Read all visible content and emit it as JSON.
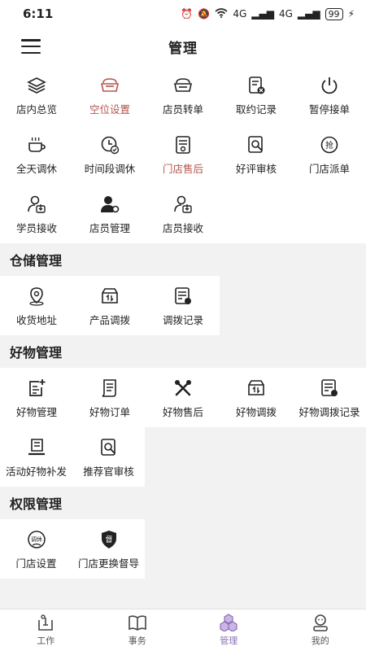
{
  "status_bar": {
    "time": "6:11",
    "network_1": "4G",
    "network_2": "4G",
    "battery": "99"
  },
  "header": {
    "title": "管理"
  },
  "sections": [
    {
      "title": "",
      "items": [
        {
          "label": "店内总览",
          "icon": "layers-icon"
        },
        {
          "label": "空位设置",
          "icon": "sofa-icon",
          "active": true
        },
        {
          "label": "店员转单",
          "icon": "sofa-transfer-icon"
        },
        {
          "label": "取约记录",
          "icon": "cancel-record-icon"
        },
        {
          "label": "暂停接单",
          "icon": "power-icon"
        },
        {
          "label": "全天调休",
          "icon": "coffee-cup-icon"
        },
        {
          "label": "时间段调休",
          "icon": "clock-check-icon"
        },
        {
          "label": "门店售后",
          "icon": "store-aftersale-icon",
          "active": true
        },
        {
          "label": "好评审核",
          "icon": "review-search-icon"
        },
        {
          "label": "门店派单",
          "icon": "grab-order-icon"
        },
        {
          "label": "学员接收",
          "icon": "person-download-icon"
        },
        {
          "label": "店员管理",
          "icon": "person-gear-icon"
        },
        {
          "label": "店员接收",
          "icon": "person-download-icon"
        }
      ]
    },
    {
      "title": "仓储管理",
      "items": [
        {
          "label": "收货地址",
          "icon": "location-pin-icon"
        },
        {
          "label": "产品调拨",
          "icon": "box-transfer-icon"
        },
        {
          "label": "调拨记录",
          "icon": "record-list-icon"
        }
      ]
    },
    {
      "title": "好物管理",
      "items": [
        {
          "label": "好物管理",
          "icon": "add-document-icon"
        },
        {
          "label": "好物订单",
          "icon": "order-scroll-icon"
        },
        {
          "label": "好物售后",
          "icon": "tools-icon"
        },
        {
          "label": "好物调拨",
          "icon": "box-transfer-icon"
        },
        {
          "label": "好物调拨记录",
          "icon": "record-list-icon"
        },
        {
          "label": "活动好物补发",
          "icon": "reissue-icon"
        },
        {
          "label": "推荐官审核",
          "icon": "review-search-icon"
        }
      ]
    },
    {
      "title": "权限管理",
      "items": [
        {
          "label": "门店设置",
          "icon": "store-settings-icon",
          "badge": "调休"
        },
        {
          "label": "门店更换督导",
          "icon": "supervisor-shield-icon",
          "badge": "督"
        }
      ]
    }
  ],
  "bottom_nav": [
    {
      "label": "工作",
      "icon": "work-icon"
    },
    {
      "label": "事务",
      "icon": "book-icon"
    },
    {
      "label": "管理",
      "icon": "cubes-icon",
      "active": true
    },
    {
      "label": "我的",
      "icon": "profile-icon"
    }
  ],
  "colors": {
    "accent": "#b5534b",
    "nav_active": "#8b6fb5"
  }
}
